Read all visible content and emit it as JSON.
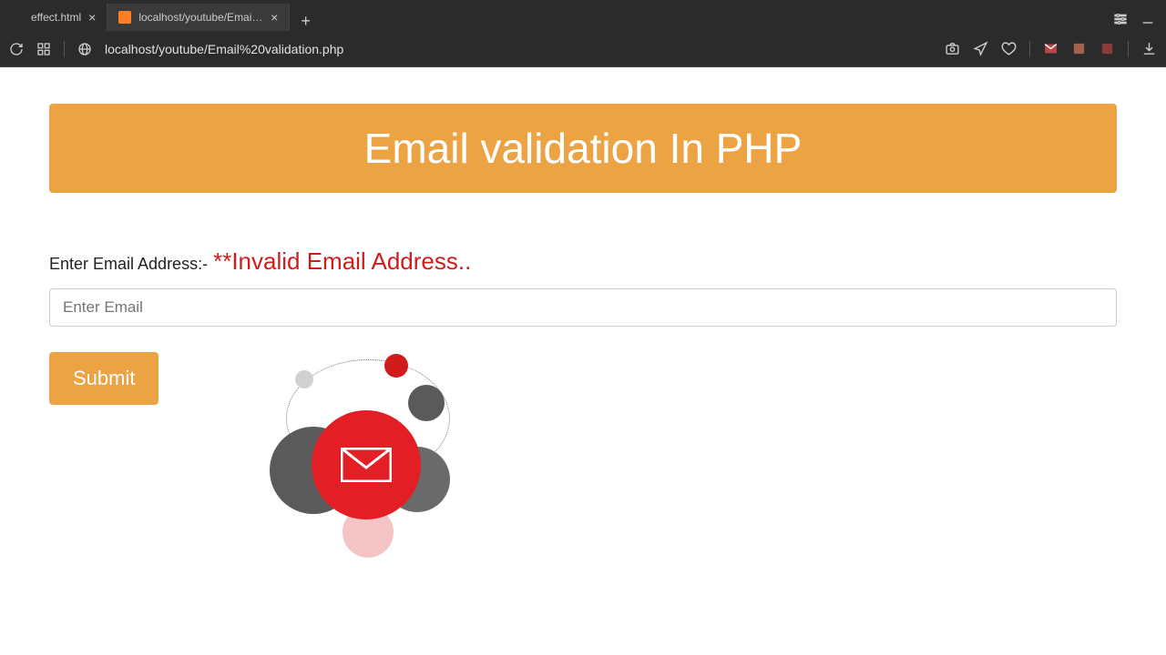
{
  "browser": {
    "tabs": [
      {
        "label": "effect.html",
        "active": false
      },
      {
        "label": "localhost/youtube/Email va",
        "active": true
      }
    ],
    "url": "localhost/youtube/Email%20validation.php"
  },
  "page": {
    "banner_title": "Email validation In PHP",
    "form_label": "Enter Email Address:-",
    "error_message": "**Invalid Email Address..",
    "email_placeholder": "Enter Email",
    "submit_label": "Submit"
  }
}
